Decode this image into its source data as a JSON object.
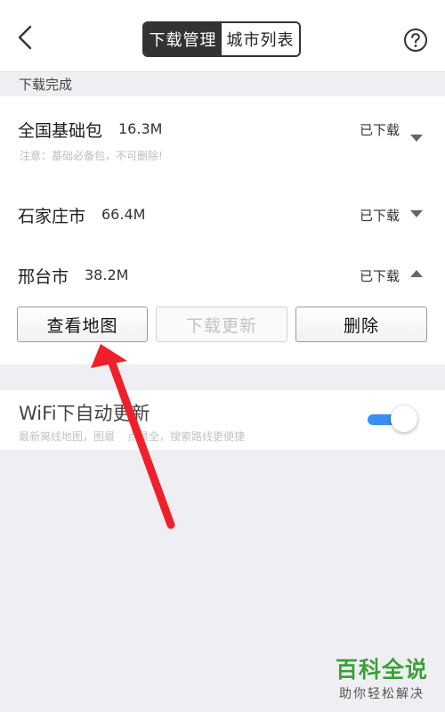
{
  "header": {
    "tabs": [
      {
        "label": "下载管理",
        "active": true
      },
      {
        "label": "城市列表",
        "active": false
      }
    ]
  },
  "section": {
    "title": "下载完成"
  },
  "packages": [
    {
      "name": "全国基础包",
      "size": "16.3M",
      "status": "已下载",
      "note": "注意：基础必备包，不可删除!",
      "expanded": false
    },
    {
      "name": "石家庄市",
      "size": "66.4M",
      "status": "已下载",
      "expanded": false
    },
    {
      "name": "邢台市",
      "size": "38.2M",
      "status": "已下载",
      "expanded": true
    }
  ],
  "actions": {
    "view_map": "查看地图",
    "update": "下载更新",
    "delete": "删除"
  },
  "wifi": {
    "title": "WiFi下自动更新",
    "desc": "最新离线地图，图最",
    "desc2": "点最全，搜索路线更便捷",
    "enabled": true
  },
  "watermark": {
    "title": "百科全说",
    "subtitle": "助你轻松解决"
  },
  "colors": {
    "accent": "#3a8ff0",
    "annotation": "#f0202a"
  }
}
